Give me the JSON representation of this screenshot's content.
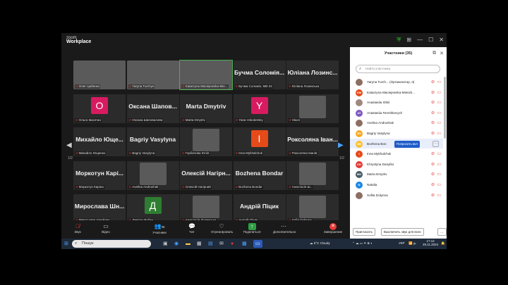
{
  "app": {
    "brand_small": "zoom",
    "brand": "Workplace"
  },
  "tiles": [
    {
      "label": "Олег Цибенко",
      "photo": true
    },
    {
      "label": "Yaryna Turchyn",
      "photo": true
    },
    {
      "label": "Katarzyna Maciejewska-Mie...",
      "photo": true,
      "active": true
    },
    {
      "name": "Бучма Соломія...",
      "label": "Бучма Соломія, МВ-34"
    },
    {
      "name": "Юліана Лозинс...",
      "label": "Юліана Лозинська"
    },
    {
      "avatar": "O",
      "color": "#d81b60",
      "label": "Ольга Івасечко"
    },
    {
      "name": "Оксана Шапов...",
      "label": "Оксана Шаповалова"
    },
    {
      "name": "Marta Dmytriv",
      "label": "Marta Dmytriv"
    },
    {
      "avatar": "Y",
      "color": "#d81b60",
      "label": "Yana Vokobetsky"
    },
    {
      "label": "Нікол",
      "photo": true,
      "small": true
    },
    {
      "name": "Михайло Юще...",
      "label": "Михайло Ющенко"
    },
    {
      "name": "Bagriy Vasylyna",
      "label": "Bagriy Vasylyna"
    },
    {
      "label": "Горбачова Юлія",
      "photo": true,
      "small": true
    },
    {
      "avatar": "I",
      "color": "#e64a19",
      "label": "Inna Mykhalchuk"
    },
    {
      "name": "Роксоляна Іван...",
      "label": "Роксоляна Іванів"
    },
    {
      "name": "Моркотун Карі...",
      "label": "Моркотун Каріна"
    },
    {
      "label": "Avelina Andrushak",
      "photo": true,
      "small": true
    },
    {
      "name": "Олексій Нагірн...",
      "label": "Олексій Нагірний"
    },
    {
      "name": "Bozhena Bondar",
      "label": "Bozhena Bondar"
    },
    {
      "label": "Анастасія Ш...",
      "photo": true,
      "small": true
    },
    {
      "name": "Мирослава Шн...",
      "label": "Мирослава Шнайдер"
    },
    {
      "avatar": "Д",
      "color": "#2e7d32",
      "label": "Дмитро Рубан"
    },
    {
      "label": "Анастасія Лозинська",
      "photo": true,
      "small": true
    },
    {
      "name": "Андрій Піцик",
      "label": "Андрій Піцик"
    },
    {
      "label": "Sofia Dolynna",
      "photo": true,
      "small": true
    }
  ],
  "pagination": {
    "left": "1/2",
    "right": "1/2"
  },
  "toolbar": {
    "mic": "Звук",
    "video": "Відео",
    "participants": "Учасники",
    "participants_count": "35",
    "chat": "Чат",
    "react": "Отреагировать",
    "share": "Поделиться",
    "more": "Дополнительно",
    "end": "Завершение"
  },
  "panel": {
    "title": "Участники (35)",
    "search_placeholder": "Найти участника",
    "participants": [
      {
        "initials": "",
        "color": "#8d6e63",
        "name": "Yaryna Turch... (Организатор, я)"
      },
      {
        "initials": "KM",
        "color": "#e64a19",
        "name": "Katarzyna Maciejewska-Mieszk..."
      },
      {
        "initials": "",
        "color": "#a1887f",
        "name": "Anastasiia Shkil"
      },
      {
        "initials": "AT",
        "color": "#7e57c2",
        "name": "Anastasiia Tereshkevych"
      },
      {
        "initials": "",
        "color": "#8d6e63",
        "name": "Avelina Andrushak"
      },
      {
        "initials": "BV",
        "color": "#f9a825",
        "name": "Bagriy Vasylyna"
      },
      {
        "initials": "BB",
        "color": "#fbc02d",
        "name": "Bozhena Bon",
        "request": "Попросить вкл"
      },
      {
        "initials": "I",
        "color": "#e64a19",
        "name": "Inna Mykhalchuk"
      },
      {
        "initials": "KD",
        "color": "#e53935",
        "name": "Khrystyna Danylko"
      },
      {
        "initials": "MD",
        "color": "#455a64",
        "name": "Marta Dmytriv"
      },
      {
        "initials": "N",
        "color": "#1e88e5",
        "name": "Natalia"
      },
      {
        "initials": "",
        "color": "#8d6e63",
        "name": "Sofiia Dolynna"
      }
    ],
    "invite": "Пригласить",
    "mute_all": "Выключить звук для всех"
  },
  "taskbar": {
    "search": "Пошук",
    "weather": "5°C  Cloudy",
    "lang": "УКР",
    "time": "17:12",
    "date": "29.11.2024"
  }
}
